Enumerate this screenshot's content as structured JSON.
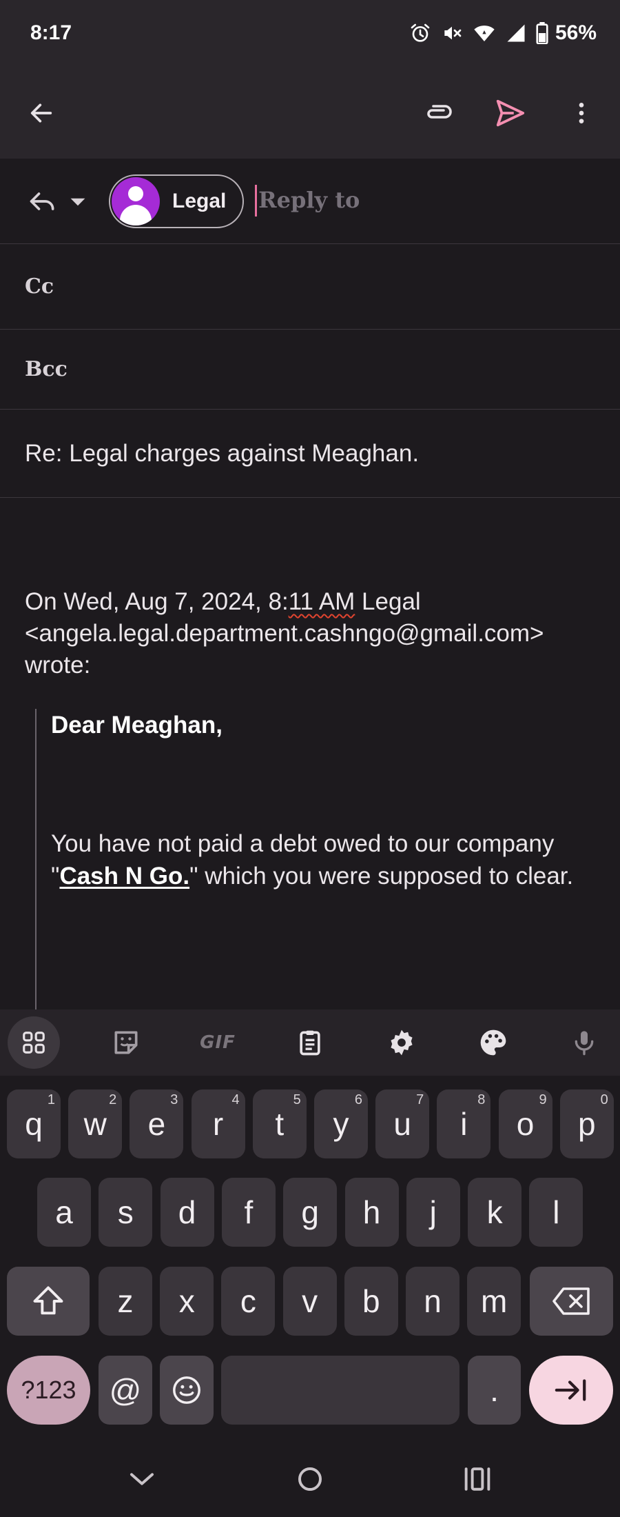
{
  "status_bar": {
    "time": "8:17",
    "battery": "56%"
  },
  "app_bar": {
    "back_icon": "arrow-left-icon",
    "attach_icon": "paperclip-icon",
    "send_icon": "send-icon",
    "more_icon": "more-vert-icon",
    "accent_color": "#f48fb1"
  },
  "compose": {
    "to_chip_label": "Legal",
    "reply_to_placeholder": "Reply to",
    "cc_label": "Cc",
    "bcc_label": "Bcc",
    "subject": "Re: Legal charges against Meaghan."
  },
  "body": {
    "quote_header_prefix": "On Wed, Aug 7, 2024, 8:",
    "quote_header_squiggle": "11 AM",
    "quote_header_rest": " Legal <angela.legal.department.cashngo@gmail.com> wrote:",
    "greeting": "Dear Meaghan,",
    "para_before": "You have not paid a debt owed to our company \"",
    "para_link": "Cash N Go.",
    "para_after": "\" which you were supposed to clear."
  },
  "keyboard": {
    "toolbar": [
      "apps-grid-icon",
      "sticker-icon",
      "GIF",
      "clipboard-icon",
      "settings-icon",
      "palette-icon",
      "mic-icon"
    ],
    "gif_label": "GIF",
    "row1": [
      {
        "k": "q",
        "h": "1"
      },
      {
        "k": "w",
        "h": "2"
      },
      {
        "k": "e",
        "h": "3"
      },
      {
        "k": "r",
        "h": "4"
      },
      {
        "k": "t",
        "h": "5"
      },
      {
        "k": "y",
        "h": "6"
      },
      {
        "k": "u",
        "h": "7"
      },
      {
        "k": "i",
        "h": "8"
      },
      {
        "k": "o",
        "h": "9"
      },
      {
        "k": "p",
        "h": "0"
      }
    ],
    "row2": [
      "a",
      "s",
      "d",
      "f",
      "g",
      "h",
      "j",
      "k",
      "l"
    ],
    "row3": [
      "z",
      "x",
      "c",
      "v",
      "b",
      "n",
      "m"
    ],
    "symbols_label": "?123",
    "at_label": "@",
    "period_label": ".",
    "enter_icon": "tab-next-icon"
  },
  "nav_bar": {
    "icons": [
      "chevron-down-icon",
      "home-circle-icon",
      "recents-icon"
    ]
  }
}
